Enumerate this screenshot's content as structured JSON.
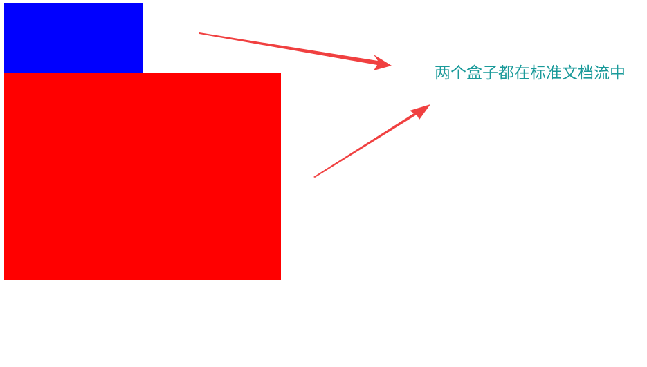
{
  "colors": {
    "blue_box": "#0000ff",
    "red_box": "#ff0000",
    "arrow": "#f04040",
    "annotation_text": "#1a9a9a",
    "background": "#ffffff"
  },
  "annotation": {
    "text": "两个盒子都在标准文档流中"
  }
}
